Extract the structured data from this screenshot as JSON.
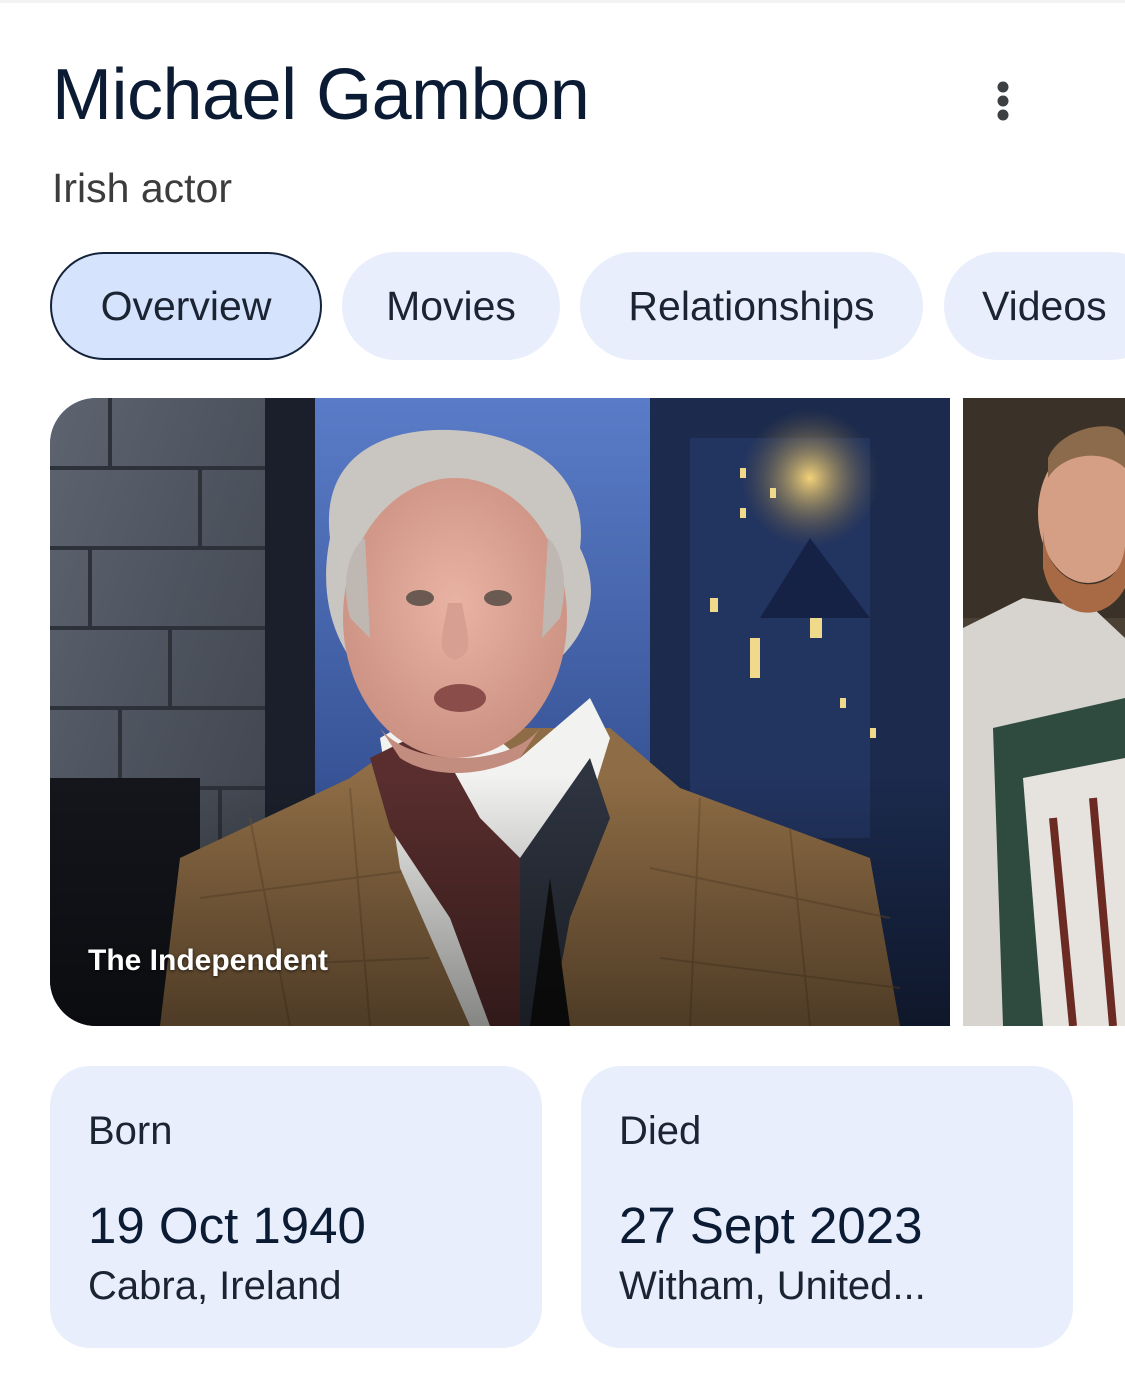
{
  "entity": {
    "name": "Michael Gambon",
    "description": "Irish actor"
  },
  "tabs": [
    {
      "label": "Overview",
      "selected": true
    },
    {
      "label": "Movies",
      "selected": false
    },
    {
      "label": "Relationships",
      "selected": false
    },
    {
      "label": "Videos",
      "selected": false
    }
  ],
  "images": {
    "main_source": "The Independent"
  },
  "facts": {
    "born": {
      "label": "Born",
      "date": "19 Oct 1940",
      "place": "Cabra, Ireland"
    },
    "died": {
      "label": "Died",
      "date": "27 Sept 2023",
      "place": "Witham, United..."
    }
  },
  "icons": {
    "menu": "more-vert-icon"
  },
  "colors": {
    "chip_bg": "#e9eefc",
    "chip_active_bg": "#d5e3fd",
    "title_text": "#0b1b33"
  }
}
